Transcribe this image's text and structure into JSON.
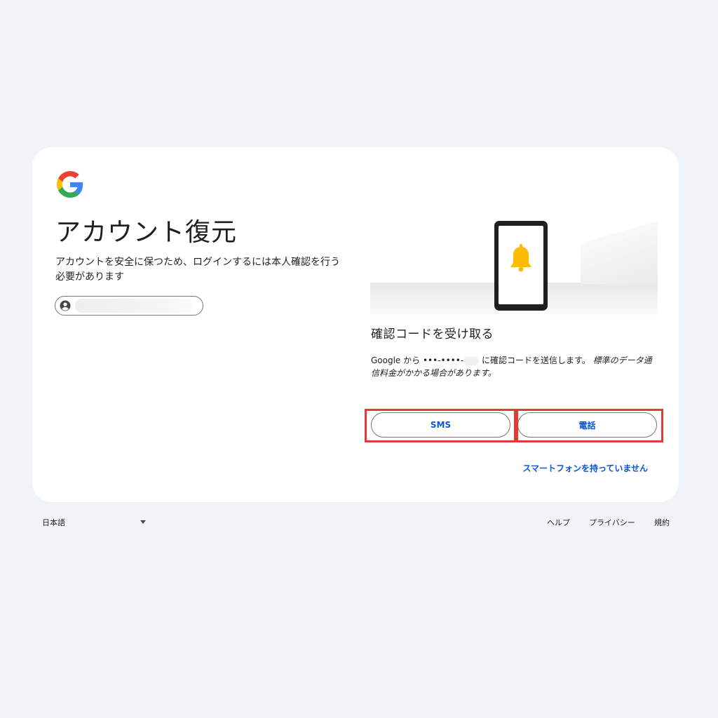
{
  "brand": {
    "colors": {
      "blue": "#4285F4",
      "red": "#EA4335",
      "yellow": "#FBBC05",
      "green": "#34A853",
      "link": "#0b57d0",
      "highlight": "#e53935"
    },
    "logo_icon": "google-g-logo"
  },
  "main": {
    "title": "アカウント復元",
    "subtitle": "アカウントを安全に保つため、ログインするには本人確認を行う必要があります",
    "account_chip": {
      "icon": "account-circle-icon"
    }
  },
  "verification": {
    "illustration_icon": "phone-bell-icon",
    "section_title": "確認コードを受け取る",
    "desc_prefix": "Google から •••-••••-",
    "desc_suffix": " に確認コードを送信します。",
    "desc_note": "標準のデータ通信料金がかかる場合があります。",
    "sms_button": "SMS",
    "call_button": "電話",
    "no_phone_link": "スマートフォンを持っていません"
  },
  "footer": {
    "language": "日本語",
    "language_icon": "caret-down-icon",
    "links": {
      "help": "ヘルプ",
      "privacy": "プライバシー",
      "terms": "規約"
    }
  }
}
